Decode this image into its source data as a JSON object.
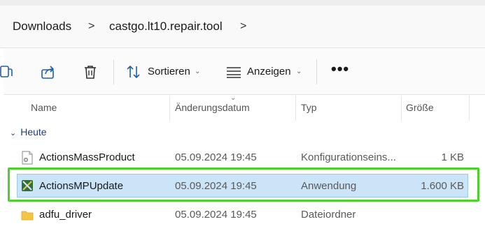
{
  "breadcrumb": {
    "items": [
      "Downloads",
      "castgo.lt10.repair.tool"
    ],
    "separator": ">"
  },
  "toolbar": {
    "sort_label": "Sortieren",
    "view_label": "Anzeigen",
    "more_label": "•••",
    "icons": [
      "copy-icon",
      "share-icon",
      "trash-icon",
      "sort-icon",
      "view-icon"
    ]
  },
  "columns": {
    "name": "Name",
    "date": "Änderungsdatum",
    "type": "Typ",
    "size": "Größe"
  },
  "group": {
    "label": "Heute",
    "chevron": "⌄"
  },
  "files": [
    {
      "name": "ActionsMassProduct",
      "date": "05.09.2024 19:45",
      "type": "Konfigurationseins...",
      "size": "1 KB",
      "icon": "config-file-icon",
      "selected": false
    },
    {
      "name": "ActionsMPUpdate",
      "date": "05.09.2024 19:45",
      "type": "Anwendung",
      "size": "1.600 KB",
      "icon": "application-icon",
      "selected": true
    },
    {
      "name": "adfu_driver",
      "date": "05.09.2024 19:45",
      "type": "Dateiordner",
      "size": "",
      "icon": "folder-icon",
      "selected": false
    }
  ],
  "colors": {
    "selection": "#cce4f7",
    "highlight": "#4bd32c",
    "folder": "#f4c542"
  }
}
